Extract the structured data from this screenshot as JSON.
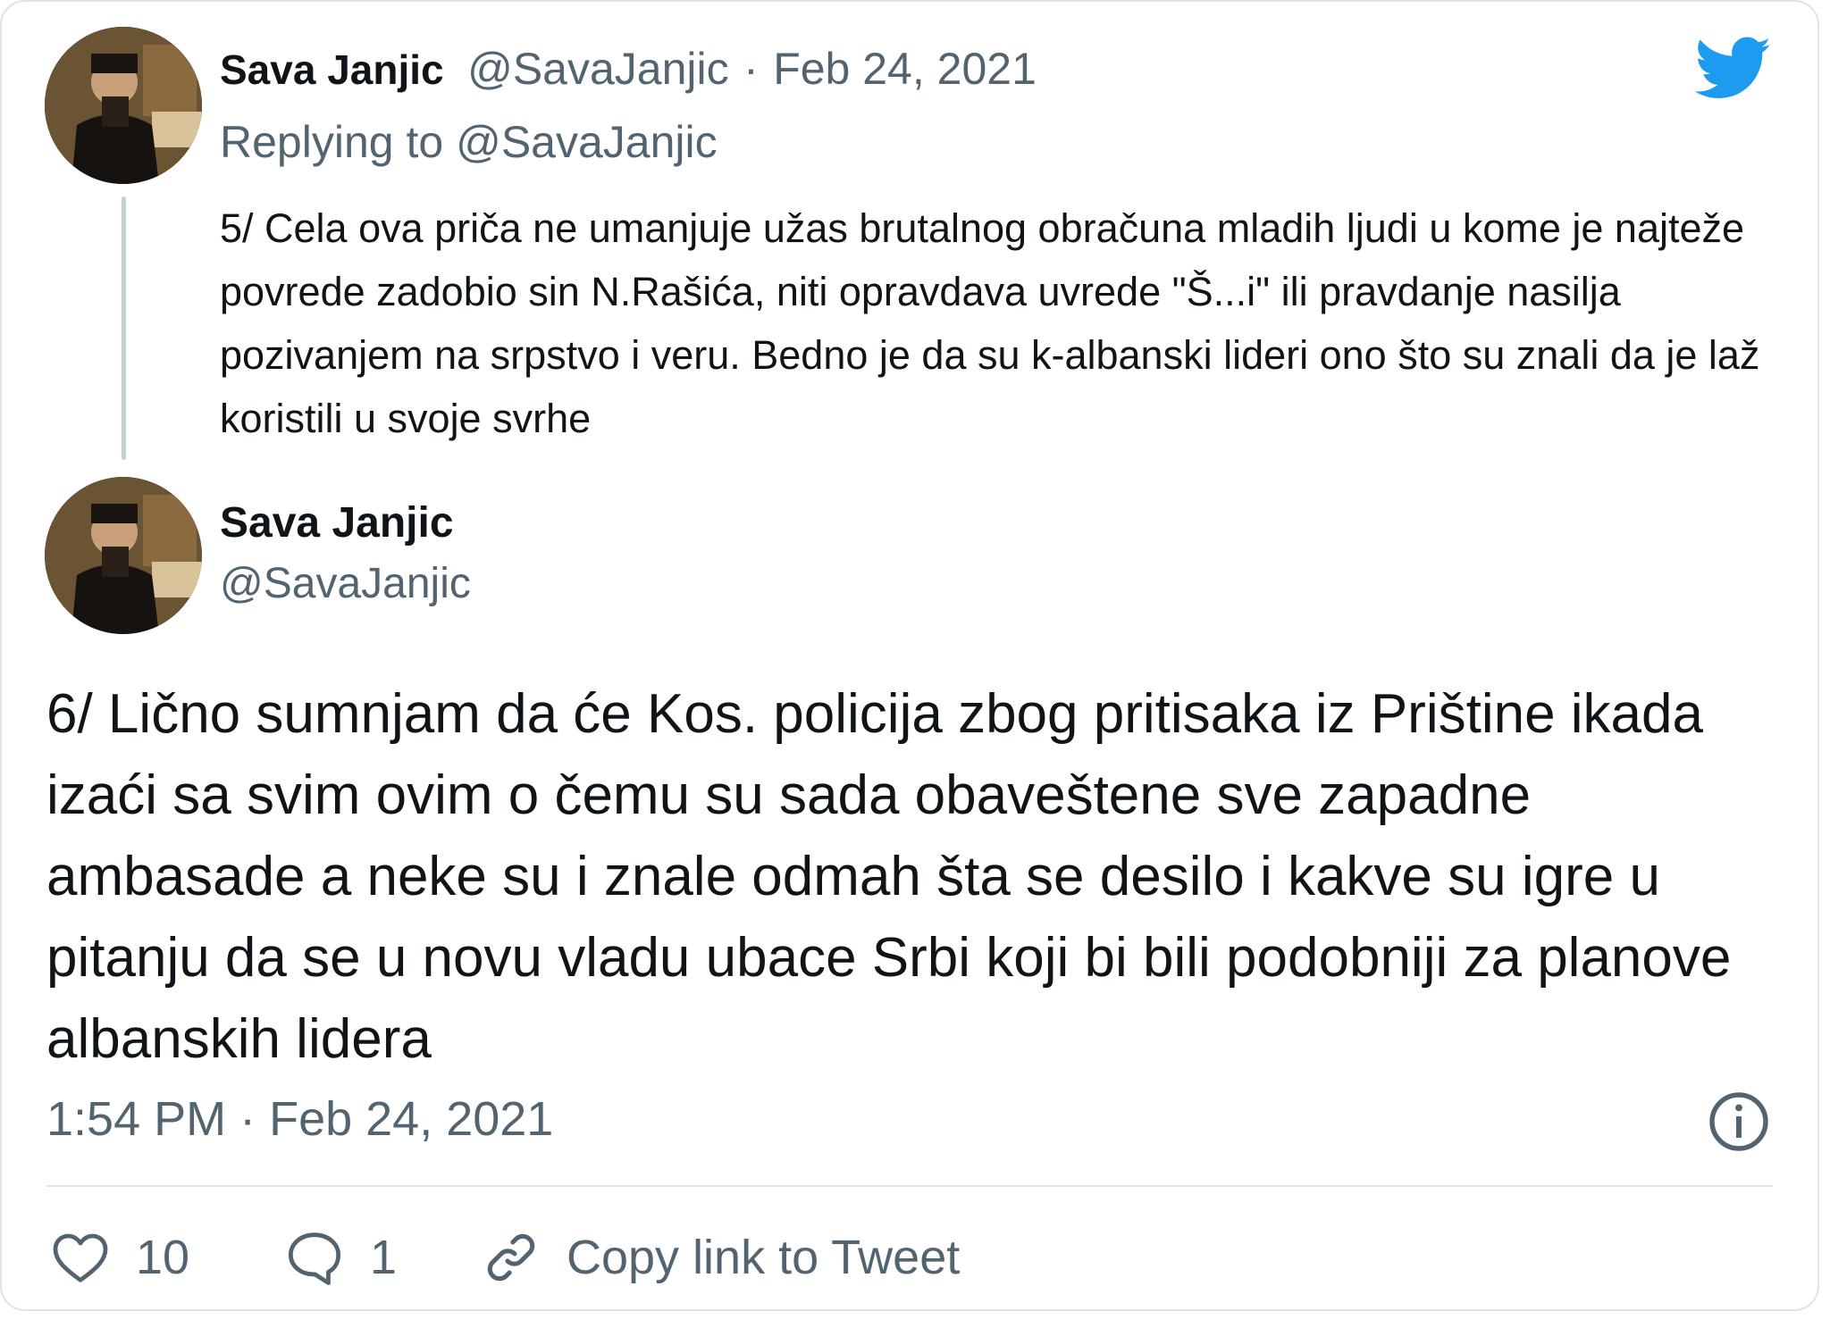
{
  "colors": {
    "twitter_blue": "#1d9bf0",
    "text_primary": "#0f1419",
    "text_secondary": "#536471",
    "divider": "#dfe3e7"
  },
  "reply_tweet": {
    "author_name": "Sava Janjic",
    "author_handle": "@SavaJanjic",
    "separator": "·",
    "date": "Feb 24, 2021",
    "replying_prefix": "Replying to",
    "replying_to": "@SavaJanjic",
    "text": "5/ Cela ova priča ne umanjuje užas brutalnog obračuna mladih ljudi u kome je najteže povrede zadobio sin N.Rašića, niti opravdava uvrede \"Š...i\" ili pravdanje nasilja pozivanjem na srpstvo i veru. Bedno je da su k-albanski lideri ono što su znali da je laž koristili u svoje svrhe"
  },
  "main_tweet": {
    "author_name": "Sava Janjic",
    "author_handle": "@SavaJanjic",
    "text": "6/ Lično sumnjam da će Kos. policija zbog pritisaka iz Prištine ikada izaći sa svim ovim o čemu su sada obaveštene sve zapadne ambasade a neke su i znale odmah šta se desilo i kakve su igre u pitanju da se u novu vladu ubace Srbi koji bi bili podobniji za planove albanskih lidera",
    "timestamp": "1:54 PM · Feb 24, 2021"
  },
  "actions": {
    "like_count": "10",
    "reply_count": "1",
    "copy_link_label": "Copy link to Tweet"
  },
  "icons": {
    "logo": "twitter-bird-icon",
    "info": "info-icon",
    "like": "heart-icon",
    "reply": "comment-bubble-icon",
    "copy": "link-icon"
  }
}
